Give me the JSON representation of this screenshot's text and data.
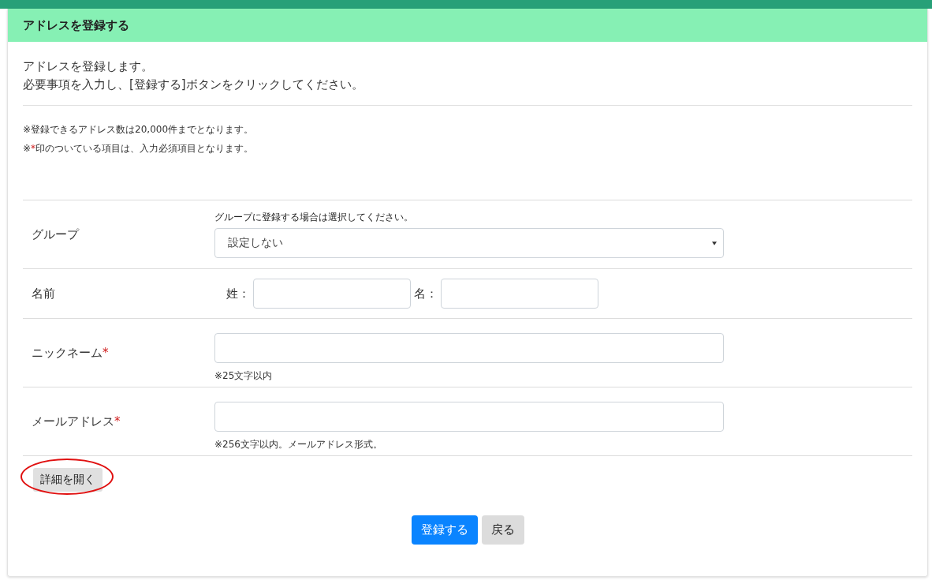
{
  "header": {
    "title": "アドレスを登録する"
  },
  "intro": [
    "アドレスを登録します。",
    "必要事項を入力し、[登録する]ボタンをクリックしてください。"
  ],
  "notes": [
    {
      "before": "※登録できるアドレス数は20,000件までとなります。"
    },
    {
      "before": "※",
      "mark": "*",
      "after": "印のついている項目は、入力必須項目となります。"
    }
  ],
  "rows": [
    {
      "kind": "select",
      "label": "グループ",
      "hint": "グループに登録する場合は選択してください。",
      "value": "設定しない"
    },
    {
      "kind": "name",
      "label": "名前",
      "fields": [
        {
          "label": "姓："
        },
        {
          "label": "名："
        }
      ]
    },
    {
      "kind": "text",
      "label": "ニックネーム",
      "required_mark": "*",
      "note": "※25文字以内"
    },
    {
      "kind": "text",
      "label": "メールアドレス",
      "required_mark": "*",
      "note": "※256文字以内。メールアドレス形式。"
    }
  ],
  "details_button": {
    "label": "詳細を開く",
    "highlighted": true
  },
  "buttons": [
    {
      "kind": "primary",
      "label": "登録する"
    },
    {
      "kind": "secondary",
      "label": "戻る"
    }
  ]
}
